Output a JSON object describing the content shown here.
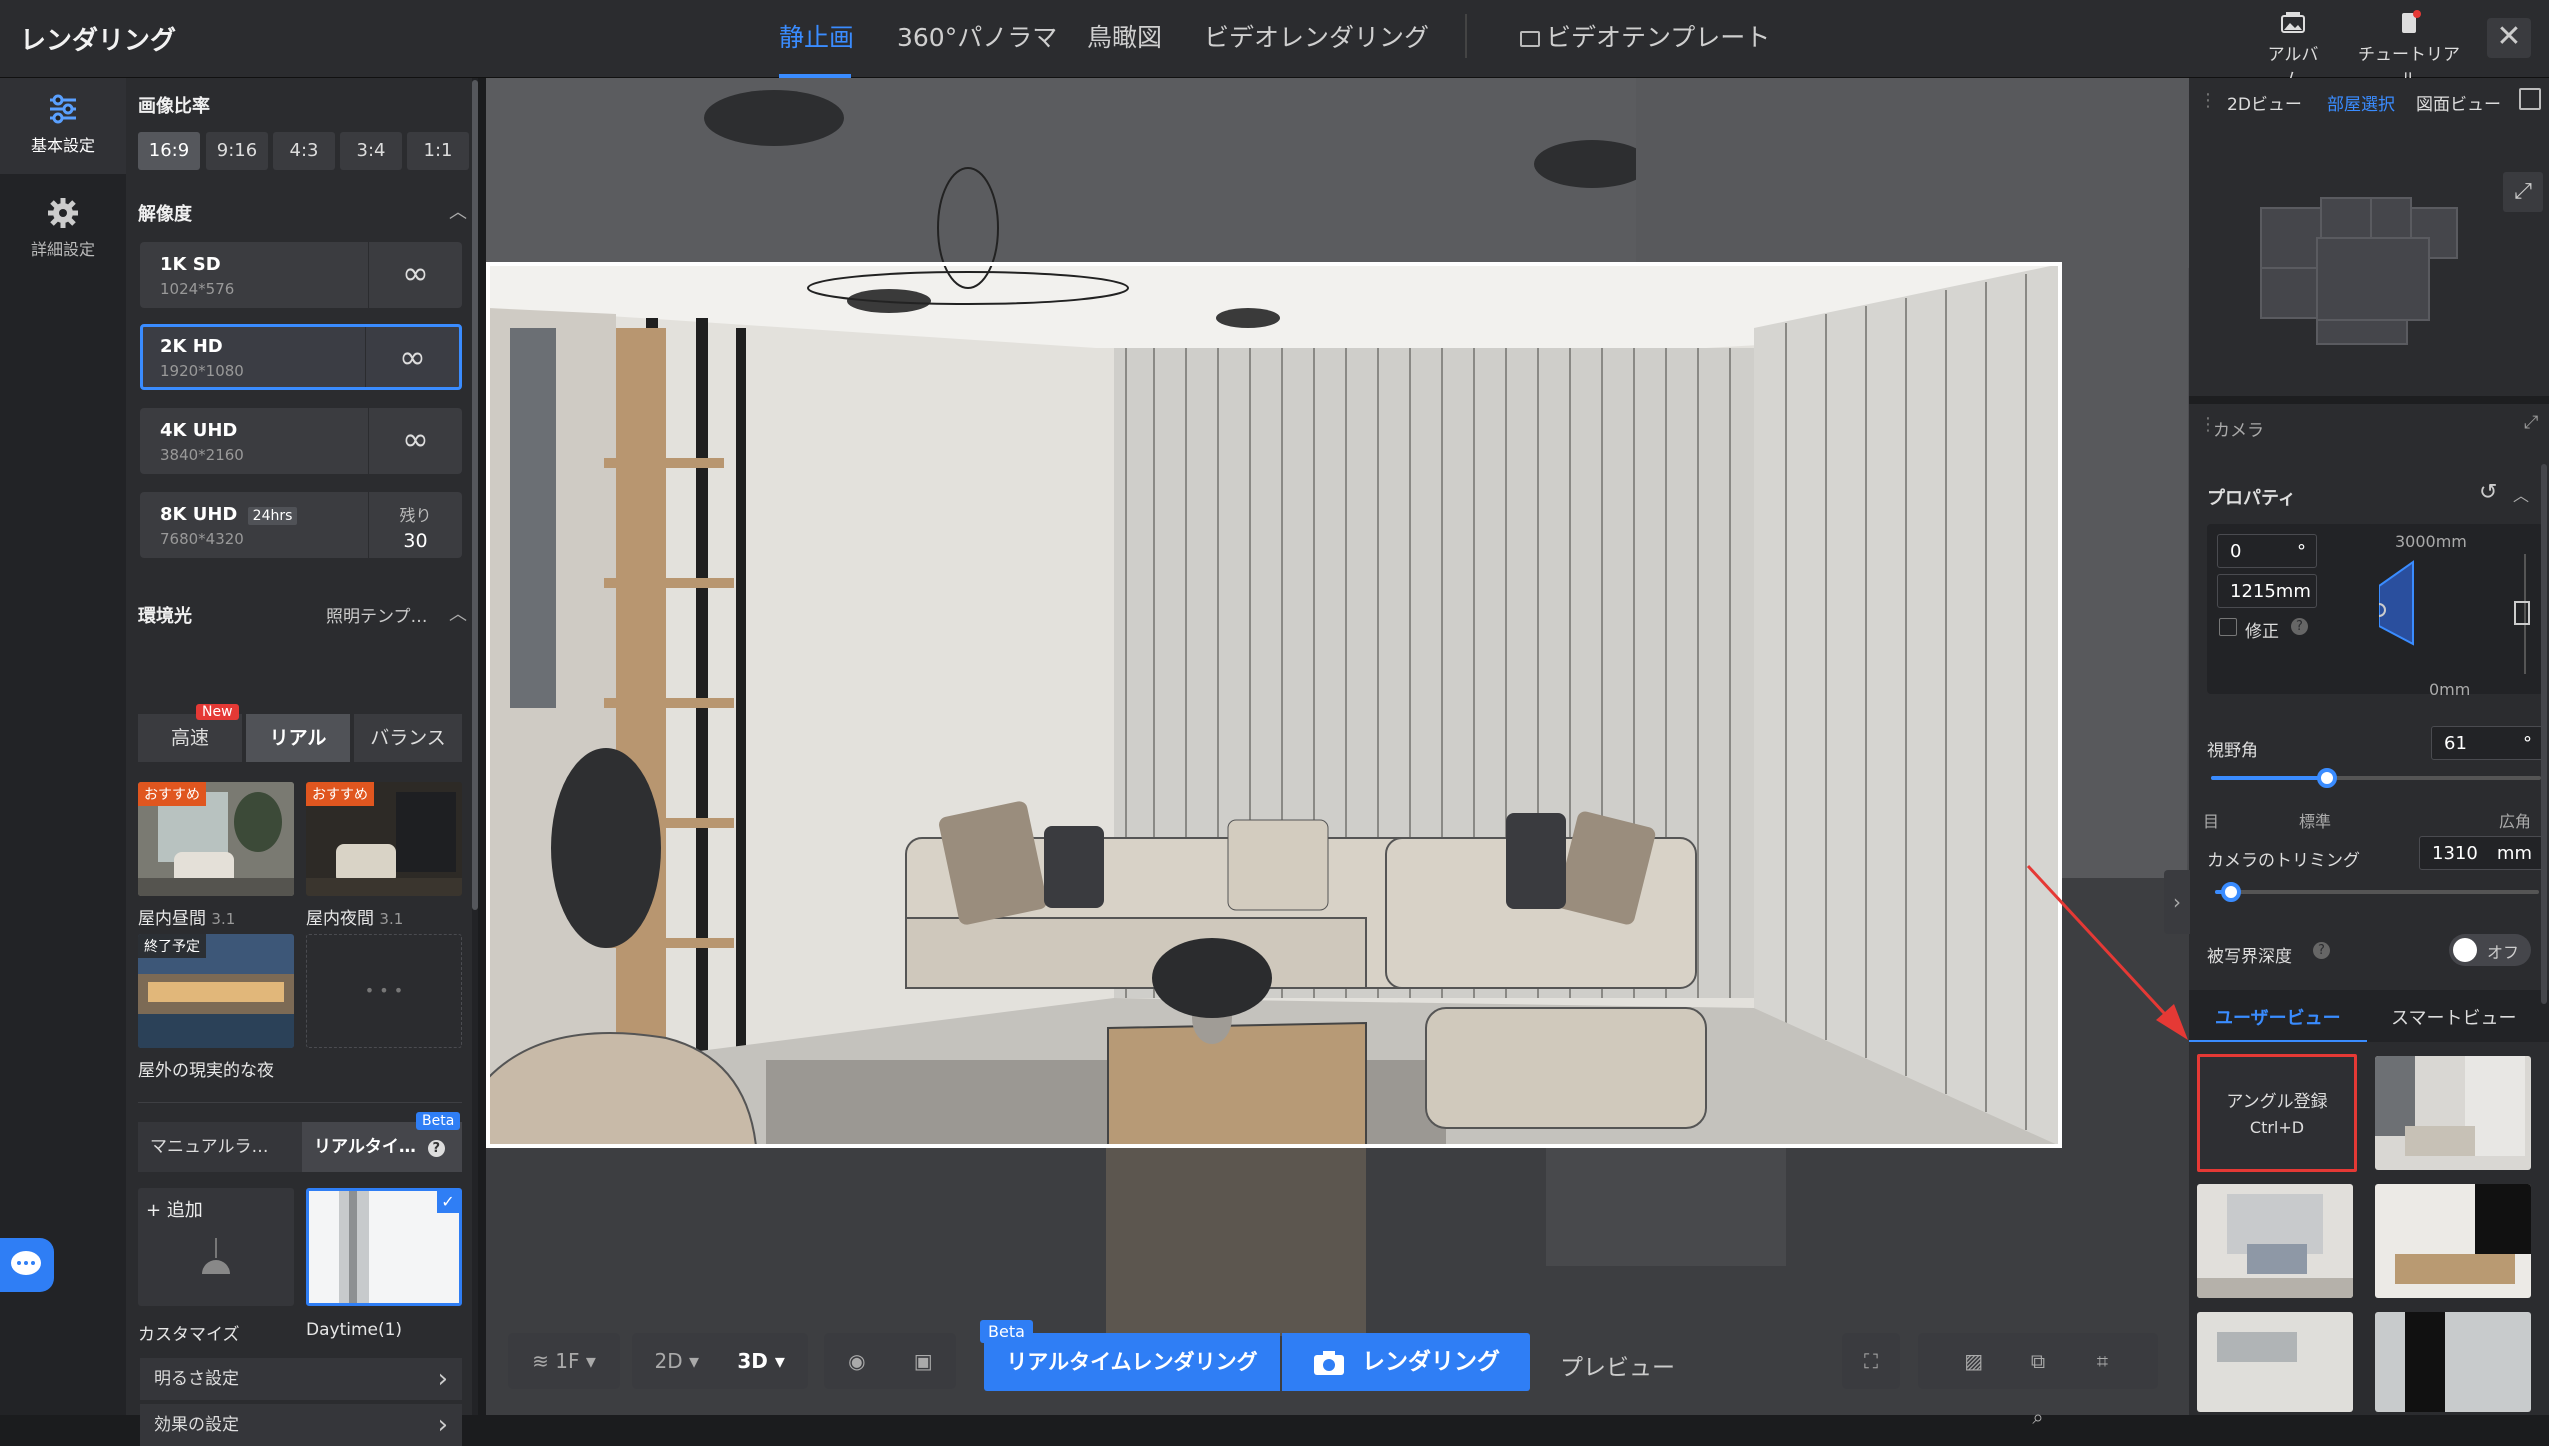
{
  "app": {
    "title": "レンダリング"
  },
  "tabs": [
    {
      "label": "静止画",
      "active": true
    },
    {
      "label": "360°パノラマ",
      "active": false
    },
    {
      "label": "鳥瞰図",
      "active": false
    },
    {
      "label": "ビデオレンダリング",
      "active": false
    },
    {
      "label": "ビデオテンプレート",
      "active": false
    }
  ],
  "top_right": {
    "album": "アルバム",
    "tutorial": "チュートリアル"
  },
  "rail": {
    "basic": "基本設定",
    "advanced": "詳細設定"
  },
  "aspect": {
    "title": "画像比率",
    "options": [
      "16:9",
      "9:16",
      "4:3",
      "3:4",
      "1:1"
    ],
    "selected": "16:9"
  },
  "resolution": {
    "title": "解像度",
    "items": [
      {
        "name": "1K SD",
        "size": "1024*576",
        "right": "∞"
      },
      {
        "name": "2K HD",
        "size": "1920*1080",
        "right": "∞",
        "selected": true
      },
      {
        "name": "4K UHD",
        "size": "3840*2160",
        "right": "∞"
      },
      {
        "name": "8K UHD",
        "tag": "24hrs",
        "size": "7680*4320",
        "remain_label": "残り",
        "remain": "30"
      }
    ]
  },
  "env_light": {
    "title": "環境光",
    "template_link": "照明テンプ…",
    "modes": [
      {
        "label": "高速",
        "badge": "New"
      },
      {
        "label": "リアル",
        "active": true
      },
      {
        "label": "バランス"
      }
    ],
    "presets": [
      {
        "label": "屋内昼間",
        "version": "3.1",
        "badge": "おすすめ"
      },
      {
        "label": "屋内夜間",
        "version": "3.1",
        "badge": "おすすめ"
      },
      {
        "label": "屋外の現実的な夜",
        "badge": "終了予定"
      },
      {
        "label": "",
        "placeholder": "• • •"
      }
    ]
  },
  "lighting": {
    "tabs": [
      {
        "label": "マニュアルラ…"
      },
      {
        "label": "リアルタイ…",
        "badge": "Beta",
        "active": true
      }
    ],
    "add_label": "+ 追加",
    "custom_label": "カスタマイズ",
    "daytime_label": "Daytime(1)",
    "rows": [
      "明るさ設定",
      "効果の設定"
    ]
  },
  "bottom_toolbar": {
    "floor": "1F",
    "view2d": "2D",
    "view3d": "3D",
    "realtime_button": "リアルタイムレンダリング",
    "realtime_badge": "Beta",
    "render_button": "レンダリング",
    "preview": "プレビュー"
  },
  "right_panel": {
    "map_tabs": [
      "2Dビュー",
      "部屋選択",
      "図面ビュー"
    ],
    "camera_title": "カメラ",
    "property_title": "プロパティ",
    "angle_value": "0",
    "angle_unit": "°",
    "height_value": "1215mm",
    "correct_label": "修正",
    "max_height": "3000mm",
    "min_height": "0mm",
    "fov_label": "視野角",
    "fov_value": "61",
    "fov_unit": "°",
    "fov_level": 0.35,
    "fov_ticks": [
      "目",
      "標準",
      "広角"
    ],
    "trim_label": "カメラのトリミング",
    "trim_value": "1310",
    "trim_unit": "mm",
    "trim_level": 0.05,
    "dof_label": "被写界深度",
    "dof_state": "オフ",
    "view_tabs": [
      "ユーザービュー",
      "スマートビュー"
    ],
    "add_angle": "アングル登録",
    "add_angle_shortcut": "Ctrl+D"
  },
  "colors": {
    "accent": "#3a8cff",
    "render_button": "#2f7ef5",
    "highlight_red": "#e53935",
    "badge_orange": "#e0561f"
  }
}
